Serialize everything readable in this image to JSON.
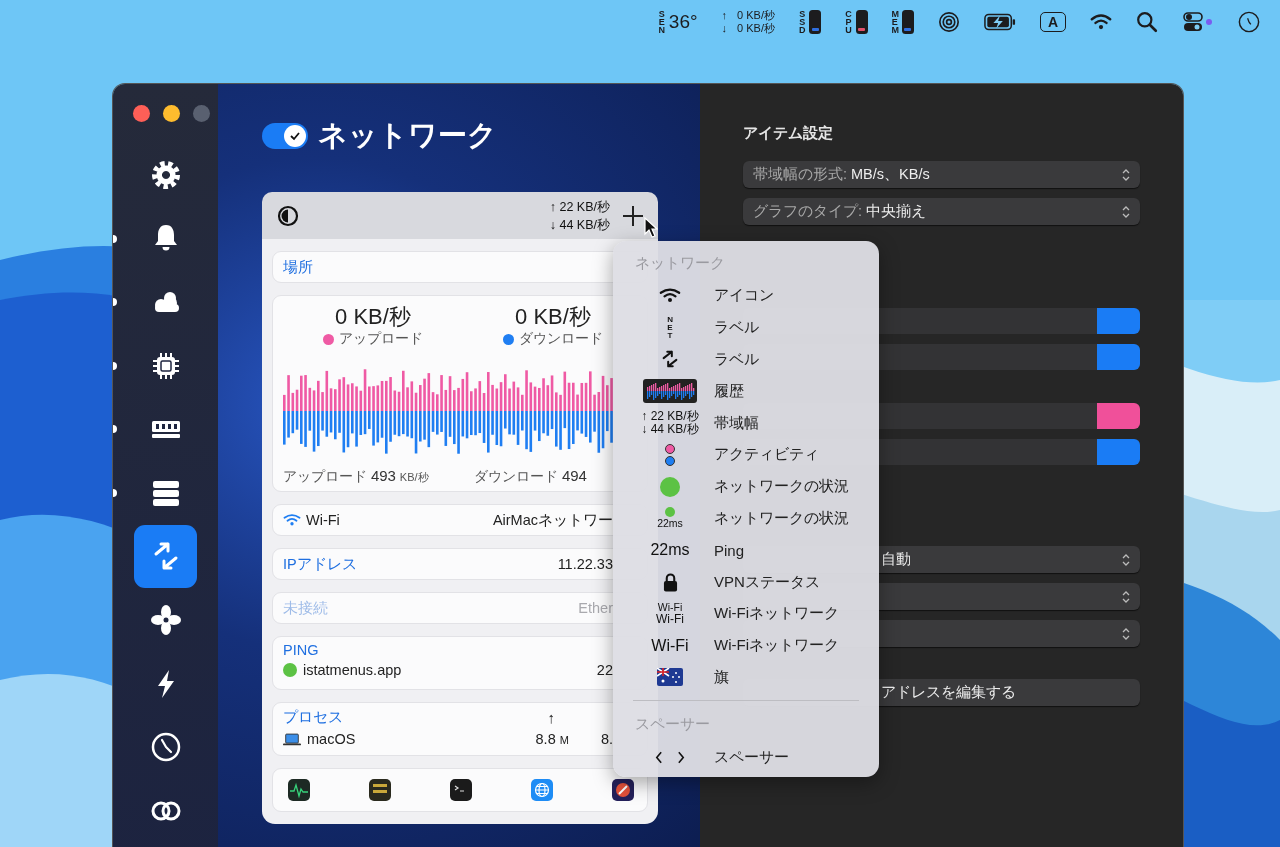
{
  "menubar": {
    "items": [
      {
        "kind": "sensor",
        "label": "SEN",
        "value": "36°"
      },
      {
        "kind": "network",
        "arrows": [
          "↑",
          "↓"
        ],
        "values": [
          "0 KB/秒",
          "0 KB/秒"
        ]
      },
      {
        "kind": "meter",
        "label": "SSD",
        "color": "#2f6fe0"
      },
      {
        "kind": "meter",
        "label": "CPU",
        "color": "#e0506a"
      },
      {
        "kind": "meter",
        "label": "MEM",
        "color": "#2f6fe0"
      },
      {
        "kind": "airdrop"
      },
      {
        "kind": "battery"
      },
      {
        "kind": "input",
        "label": "A"
      },
      {
        "kind": "wifi"
      },
      {
        "kind": "search"
      },
      {
        "kind": "control-center"
      },
      {
        "kind": "clock"
      }
    ]
  },
  "sidebar": {
    "items": [
      {
        "kind": "gear",
        "selected": false,
        "indicator": false
      },
      {
        "kind": "bell",
        "selected": false,
        "indicator": true
      },
      {
        "kind": "weather",
        "selected": false,
        "indicator": true
      },
      {
        "kind": "chip",
        "selected": false,
        "indicator": true
      },
      {
        "kind": "memory",
        "selected": false,
        "indicator": true
      },
      {
        "kind": "disks",
        "selected": false,
        "indicator": true
      },
      {
        "kind": "network",
        "selected": true,
        "indicator": false
      },
      {
        "kind": "fan",
        "selected": false,
        "indicator": false
      },
      {
        "kind": "bolt",
        "selected": false,
        "indicator": false
      },
      {
        "kind": "gauge",
        "selected": false,
        "indicator": false
      },
      {
        "kind": "rings",
        "selected": false,
        "indicator": false
      }
    ]
  },
  "header": {
    "title": "ネットワーク",
    "enabled": true
  },
  "preview": {
    "lines": [
      "↑ 22 KB/秒",
      "↓ 44 KB/秒"
    ]
  },
  "dropdown": {
    "location": {
      "label": "場所"
    },
    "traffic": {
      "legend": [
        {
          "value": "0 KB/秒",
          "label": "アップロード",
          "color": "#ef5aa4"
        },
        {
          "value": "0 KB/秒",
          "label": "ダウンロード",
          "color": "#1f7ef2"
        }
      ],
      "totals": [
        {
          "label": "アップロード",
          "value": "493",
          "unit": "KB/秒"
        },
        {
          "label": "ダウンロード",
          "value": "494"
        }
      ]
    },
    "rows": [
      {
        "kind": "wifi",
        "label": "Wi-Fi",
        "value": "AirMacネットワー",
        "disabled": false
      },
      {
        "kind": "plain",
        "label": "IPアドレス",
        "value": "11.22.33",
        "disabled": false
      },
      {
        "kind": "plain",
        "label": "未接続",
        "value": "Ether",
        "disabled": true
      }
    ],
    "ping": {
      "title": "PING",
      "host": "istatmenus.app",
      "color": "#5cc244",
      "value": "22"
    },
    "processes": {
      "title": "プロセス",
      "column": "↑",
      "rows": [
        {
          "name": "macOS",
          "up": "8.8",
          "unit": "M",
          "down": "8."
        }
      ]
    },
    "apps": [
      {
        "kind": "activity"
      },
      {
        "kind": "console"
      },
      {
        "kind": "terminal"
      },
      {
        "kind": "globe"
      },
      {
        "kind": "istat"
      }
    ]
  },
  "menu": {
    "sections": [
      {
        "title": "ネットワーク",
        "items": [
          {
            "kind": "wifi",
            "label": "アイコン"
          },
          {
            "kind": "net-label",
            "preview": "NET",
            "label": "ラベル"
          },
          {
            "kind": "arrows",
            "label": "ラベル"
          },
          {
            "kind": "history",
            "label": "履歴"
          },
          {
            "kind": "bandwidth",
            "lines": [
              "↑ 22 KB/秒",
              "↓ 44 KB/秒"
            ],
            "label": "帯域幅"
          },
          {
            "kind": "activity",
            "label": "アクティビティ"
          },
          {
            "kind": "status",
            "label": "ネットワークの状況"
          },
          {
            "kind": "status-ping",
            "preview": "22ms",
            "label": "ネットワークの状況"
          },
          {
            "kind": "ping",
            "preview": "22ms",
            "label": "Ping"
          },
          {
            "kind": "lock",
            "label": "VPNステータス"
          },
          {
            "kind": "wifi-two",
            "lines": [
              "Wi-Fi",
              "Wi-Fi"
            ],
            "label": "Wi-Fiネットワーク"
          },
          {
            "kind": "wifi-name",
            "preview": "Wi-Fi",
            "label": "Wi-Fiネットワーク"
          },
          {
            "kind": "flag",
            "label": "旗"
          }
        ]
      },
      {
        "title": "スペーサー",
        "items": [
          {
            "kind": "spacer",
            "label": "スペーサー"
          }
        ]
      }
    ]
  },
  "settings": {
    "title": "アイテム設定",
    "groups": [
      {
        "controls": [
          {
            "kind": "popup",
            "label": "帯域幅の形式:",
            "value": "MB/s、KB/s"
          },
          {
            "kind": "popup",
            "label": "グラフのタイプ:",
            "value": "中央揃え"
          }
        ]
      },
      {
        "controls": [
          {
            "kind": "color",
            "color": "#1a7cf5"
          },
          {
            "kind": "color",
            "color": "#1a7cf5"
          }
        ]
      },
      {
        "controls": [
          {
            "kind": "color",
            "color": "#f0509a"
          },
          {
            "kind": "color",
            "color": "#1a7cf5"
          }
        ]
      },
      {
        "controls": [
          {
            "kind": "popup",
            "value": "自動"
          },
          {
            "kind": "popup"
          },
          {
            "kind": "popup"
          }
        ]
      },
      {
        "controls": [
          {
            "kind": "button",
            "label": "アドレスを編集する"
          }
        ]
      }
    ]
  }
}
